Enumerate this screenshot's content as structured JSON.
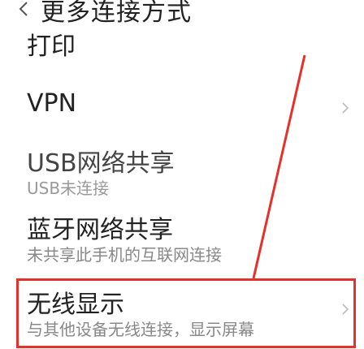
{
  "header": {
    "title": "更多连接方式",
    "back_icon": "chevron-left-icon"
  },
  "rows": {
    "print": {
      "title": "打印"
    },
    "vpn": {
      "title": "VPN"
    },
    "usb_share": {
      "title": "USB网络共享",
      "sub": "USB未连接"
    },
    "bt_share": {
      "title": "蓝牙网络共享",
      "sub": "未共享此手机的互联网连接"
    },
    "wireless_display": {
      "title": "无线显示",
      "sub": "与其他设备无线连接，显示屏幕"
    }
  },
  "annotation": {
    "color": "#e4312b"
  }
}
